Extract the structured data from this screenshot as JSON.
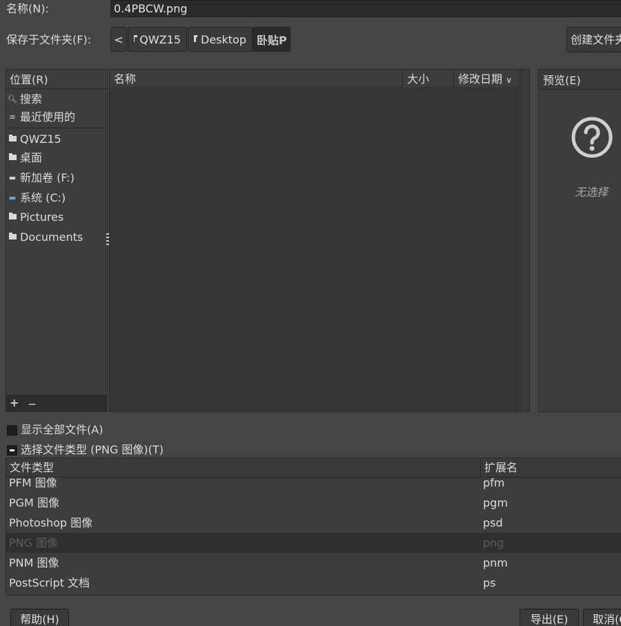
{
  "name_row": {
    "label": "名称(N):",
    "value": "0.4PBCW.png"
  },
  "folder_row": {
    "label": "保存于文件夹(F):",
    "back": "<",
    "crumbs": [
      "QWZ15",
      "Desktop",
      "卧贴P"
    ],
    "create_button": "创建文件夹"
  },
  "places": {
    "header": "位置(R)",
    "items": [
      {
        "label": "搜索",
        "icon": "search-icon"
      },
      {
        "label": "最近使用的",
        "icon": "recent-icon"
      },
      {
        "label": "QWZ15",
        "icon": "folder-icon"
      },
      {
        "label": "桌面",
        "icon": "folder-icon"
      },
      {
        "label": "新加卷 (F:)",
        "icon": "drive-icon"
      },
      {
        "label": "系统 (C:)",
        "icon": "system-drive-icon"
      },
      {
        "label": "Pictures",
        "icon": "folder-icon"
      },
      {
        "label": "Documents",
        "icon": "folder-icon"
      }
    ],
    "footer_add": "+",
    "footer_remove": "—"
  },
  "file_list": {
    "col_name": "名称",
    "col_size": "大小",
    "col_modified": "修改日期"
  },
  "preview": {
    "header": "预览(E)",
    "empty_text": "无选择"
  },
  "options": {
    "show_all": "显示全部文件(A)",
    "select_type": "选择文件类型 (PNG 图像)(T)"
  },
  "file_types": {
    "col_type": "文件类型",
    "col_ext": "扩展名",
    "rows": [
      {
        "type": "PFM 图像",
        "ext": "pfm"
      },
      {
        "type": "PGM 图像",
        "ext": "pgm"
      },
      {
        "type": "Photoshop 图像",
        "ext": "psd"
      },
      {
        "type": "PNG 图像",
        "ext": "png"
      },
      {
        "type": "PNM 图像",
        "ext": "pnm"
      },
      {
        "type": "PostScript 文档",
        "ext": "ps"
      }
    ]
  },
  "buttons": {
    "help": "帮助(H)",
    "export": "导出(E)",
    "cancel": "取消(C)"
  },
  "colors": {
    "background": "#454545",
    "panel": "#3d3d3d",
    "list": "#353535",
    "text": "#dcdcdc"
  }
}
